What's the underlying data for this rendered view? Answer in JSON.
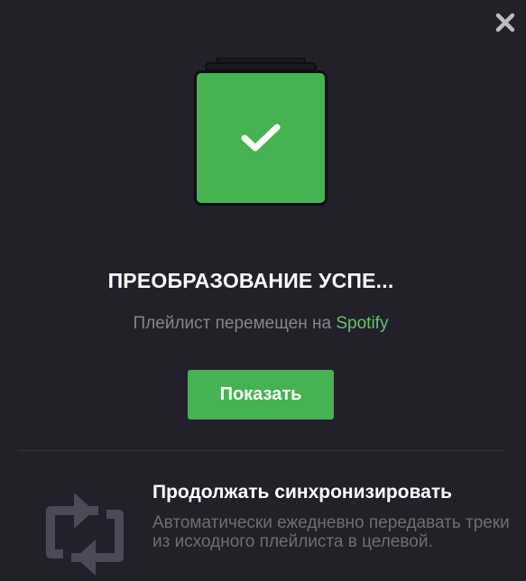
{
  "dialog": {
    "close_icon": "close-icon",
    "status_icon": "checkmark-icon",
    "title": "ПРЕОБРАЗОВАНИЕ УСПЕ...",
    "subtitle_prefix": "Плейлист перемещен на ",
    "subtitle_service": "Spotify",
    "show_button": "Показать"
  },
  "sync": {
    "icon": "sync-arrows-icon",
    "title": "Продолжать синхронизировать",
    "description": "Автоматически ежедневно передавать треки из исходного плейлиста в целевой."
  },
  "colors": {
    "background": "#22202a",
    "accent_green": "#47b252",
    "link_green": "#5fc768",
    "muted_text": "#86848c",
    "icon_gray": "#4c4a58"
  }
}
